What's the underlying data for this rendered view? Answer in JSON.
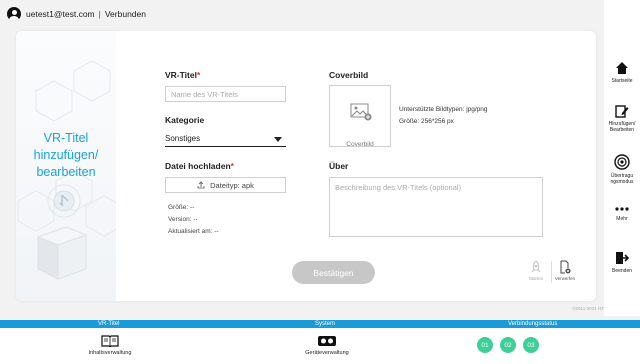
{
  "topbar": {
    "user_email": "uetest1@test.com",
    "separator": "|",
    "status": "Verbunden"
  },
  "hero": {
    "title_line1": "VR-Titel",
    "title_line2": "hinzufügen/",
    "title_line3": "bearbeiten"
  },
  "form": {
    "title_label": "VR-Titel",
    "required_mark": "*",
    "title_placeholder": "Name des VR-Titels",
    "category_label": "Kategorie",
    "category_value": "Sonstiges",
    "upload_label": "Datei hochladen",
    "upload_button": "Dateityp: apk",
    "size_line": "Größe: --",
    "version_line": "Version: --",
    "updated_line": "Aktualisiert am: --",
    "cover_label": "Coverbild",
    "cover_box_label": "Coverbild",
    "cover_types": "Unterstützte Bildtypen: jpg/png",
    "cover_size": "Größe: 256*256 px",
    "about_label": "Über",
    "about_placeholder": "Beschreibung des VR-Titels (optional)",
    "confirm_button": "Bestätigen",
    "action_start": "Starten",
    "action_discard": "Verwerfen"
  },
  "copyright": "©2011-2021 HTC Corporation",
  "sidebar": {
    "home": "Startseite",
    "add_edit_line1": "Hinzufügen/",
    "add_edit_line2": "Bearbeiten",
    "transfer_line1": "Übertragu",
    "transfer_line2": "ngsmodus",
    "more": "Mehr",
    "exit": "Beenden"
  },
  "bottom": {
    "section_vr": "VR-Titel",
    "section_system": "System",
    "section_conn": "Verbindungsstatus",
    "content_mgmt": "Inhaltsverwaltung",
    "device_mgmt": "Geräteverwaltung",
    "conn_items": [
      "01",
      "02",
      "03"
    ]
  },
  "colors": {
    "accent": "#1a9ad6",
    "hero_text": "#1aa3d9",
    "status_green": "#3ccf98",
    "required": "#d9342b",
    "button_disabled": "#c7c7c7"
  },
  "icons": [
    "avatar-icon",
    "upload-icon",
    "image-add-icon",
    "rocket-icon",
    "file-discard-icon",
    "home-icon",
    "edit-icon",
    "broadcast-icon",
    "more-dots-icon",
    "exit-icon",
    "book-icon",
    "headset-icon"
  ]
}
